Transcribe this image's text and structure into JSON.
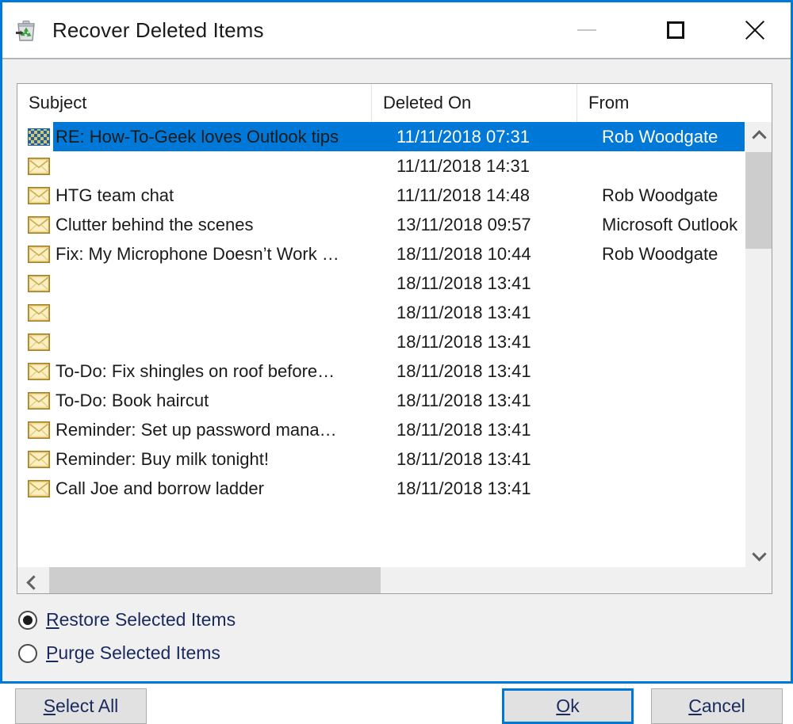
{
  "window": {
    "title": "Recover Deleted Items",
    "icon": "recycle-bin-recover-icon",
    "border_color": "#0078d7",
    "background": "#f0f0f0",
    "controls": {
      "minimize": {
        "label": "—",
        "icon": "minimize-icon",
        "state": "disabled"
      },
      "maximize": {
        "label": "□",
        "icon": "maximize-icon",
        "state": "enabled"
      },
      "close": {
        "label": "✕",
        "icon": "close-icon",
        "state": "enabled"
      }
    }
  },
  "list": {
    "columns": [
      {
        "key": "subject",
        "label": "Subject"
      },
      {
        "key": "deleted_on",
        "label": "Deleted On"
      },
      {
        "key": "from",
        "label": "From"
      }
    ],
    "selection_color": "#0078d7",
    "rows": [
      {
        "icon": "envelope-icon-selected",
        "subject": "RE: How-To-Geek loves Outlook tips",
        "deleted_on": "11/11/2018 07:31",
        "from": "Rob Woodgate",
        "selected": true
      },
      {
        "icon": "envelope-icon",
        "subject": "",
        "deleted_on": "11/11/2018 14:31",
        "from": "",
        "selected": false
      },
      {
        "icon": "envelope-icon",
        "subject": "HTG team chat",
        "deleted_on": "11/11/2018 14:48",
        "from": "Rob Woodgate",
        "selected": false
      },
      {
        "icon": "envelope-icon",
        "subject": "Clutter behind the scenes",
        "deleted_on": "13/11/2018 09:57",
        "from": "Microsoft Outlook",
        "selected": false
      },
      {
        "icon": "envelope-icon",
        "subject": "Fix: My Microphone Doesn’t Work …",
        "deleted_on": "18/11/2018 10:44",
        "from": "Rob Woodgate",
        "selected": false
      },
      {
        "icon": "envelope-icon",
        "subject": "",
        "deleted_on": "18/11/2018 13:41",
        "from": "",
        "selected": false
      },
      {
        "icon": "envelope-icon",
        "subject": "",
        "deleted_on": "18/11/2018 13:41",
        "from": "",
        "selected": false
      },
      {
        "icon": "envelope-icon",
        "subject": "",
        "deleted_on": "18/11/2018 13:41",
        "from": "",
        "selected": false
      },
      {
        "icon": "envelope-icon",
        "subject": "To-Do: Fix shingles on roof before…",
        "deleted_on": "18/11/2018 13:41",
        "from": "",
        "selected": false
      },
      {
        "icon": "envelope-icon",
        "subject": "To-Do: Book haircut",
        "deleted_on": "18/11/2018 13:41",
        "from": "",
        "selected": false
      },
      {
        "icon": "envelope-icon",
        "subject": "Reminder: Set up password mana…",
        "deleted_on": "18/11/2018 13:41",
        "from": "",
        "selected": false
      },
      {
        "icon": "envelope-icon",
        "subject": "Reminder: Buy milk tonight!",
        "deleted_on": "18/11/2018 13:41",
        "from": "",
        "selected": false
      },
      {
        "icon": "envelope-icon",
        "subject": "Call Joe and borrow ladder",
        "deleted_on": "18/11/2018 13:41",
        "from": "",
        "selected": false
      }
    ]
  },
  "scrollbars": {
    "vertical": {
      "up_icon": "chevron-up-icon",
      "down_icon": "chevron-down-icon",
      "thumb_color": "#cdcdcd",
      "track_color": "#f0f0f0"
    },
    "horizontal": {
      "left_icon": "chevron-left-icon",
      "right_icon": "chevron-right-icon",
      "thumb_color": "#cdcdcd",
      "track_color": "#f0f0f0"
    }
  },
  "options": {
    "restore": {
      "accel": "R",
      "rest": "estore Selected Items",
      "selected": true
    },
    "purge": {
      "accel": "P",
      "rest": "urge Selected Items",
      "selected": false
    }
  },
  "buttons": {
    "select_all": {
      "accel": "S",
      "rest": "elect All"
    },
    "ok": {
      "accel": "O",
      "rest": "k",
      "default": true
    },
    "cancel": {
      "accel": "C",
      "rest": "ancel"
    }
  }
}
